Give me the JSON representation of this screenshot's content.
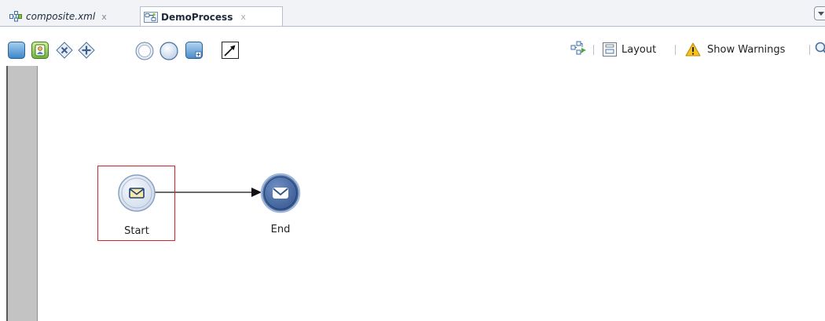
{
  "tabs": [
    {
      "label": "composite.xml",
      "close": "x",
      "icon": "composite-icon",
      "active": false
    },
    {
      "label": "DemoProcess",
      "close": "x",
      "icon": "process-icon",
      "active": true
    }
  ],
  "toolbar": {
    "palette": [
      "activity-icon",
      "user-task-icon",
      "exclusive-gateway-icon",
      "parallel-gateway-icon",
      "start-event-icon",
      "end-event-icon",
      "subprocess-icon",
      "annotation-icon"
    ],
    "right": {
      "layout_label": "Layout",
      "warnings_label": "Show Warnings"
    }
  },
  "diagram": {
    "nodes": [
      {
        "id": "start",
        "label": "Start",
        "type": "message-start-event",
        "selected": true
      },
      {
        "id": "end",
        "label": "End",
        "type": "message-end-event",
        "selected": false
      }
    ],
    "edges": [
      {
        "from": "start",
        "to": "end"
      }
    ]
  },
  "colors": {
    "selection": "#d6232a",
    "start_fill": "#dfe7f2",
    "end_fill": "#3e5e95",
    "rail": "#c3c3c3"
  }
}
